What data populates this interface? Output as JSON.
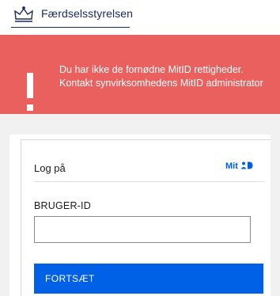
{
  "header": {
    "agency_name": "Færdselsstyrelsen",
    "logo_icon": "crown-icon"
  },
  "alert": {
    "icon": "exclamation-icon",
    "message": "Du har ikke de fornødne MitID rettigheder. Kontakt synvirksomhedens MitID administrator",
    "color": "#e9605f"
  },
  "login": {
    "title": "Log på",
    "provider_logo": "Mit",
    "provider_icon": "mitid-icon",
    "field_label": "BRUGER-ID",
    "field_value": "",
    "continue_label": "FORTSÆT",
    "accent_color": "#0060e6"
  }
}
